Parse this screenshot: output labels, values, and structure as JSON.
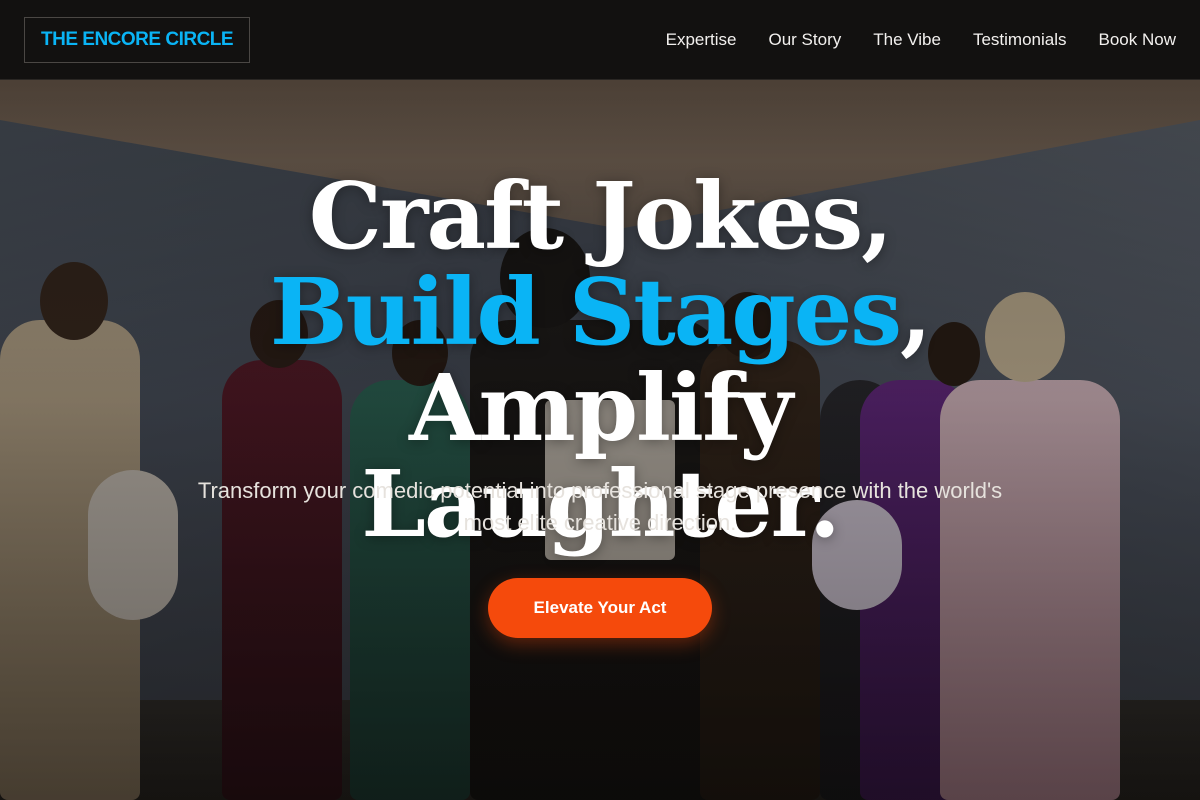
{
  "brand": {
    "logo_text": "THE ENCORE CIRCLE",
    "accent_color": "#0ab4f5",
    "cta_color": "#f54a0c"
  },
  "nav": {
    "items": [
      {
        "label": "Expertise"
      },
      {
        "label": "Our Story"
      },
      {
        "label": "The Vibe"
      },
      {
        "label": "Testimonials"
      },
      {
        "label": "Book Now"
      }
    ]
  },
  "hero": {
    "headline_part1": "Craft Jokes, ",
    "headline_accent": "Build Stages",
    "headline_part2": ", Amplify Laughter.",
    "subheadline": "Transform your comedic potential into professional stage presence with the world's most elite creative direction.",
    "cta_label": "Elevate Your Act"
  }
}
